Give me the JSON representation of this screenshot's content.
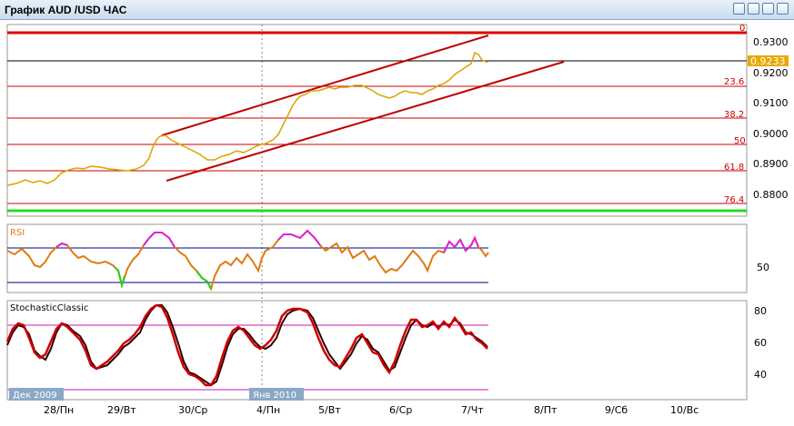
{
  "window": {
    "title": "График AUD /USD  ЧАС",
    "buttons": [
      "pause",
      "tile",
      "maximize",
      "close"
    ]
  },
  "colors": {
    "price": "#d9a400",
    "channel": "#c00000",
    "fib": "#cc0000",
    "fib_top": "#e00000",
    "green_line": "#22dd22",
    "current_price_bg": "#e8a800",
    "rsi_high": "#dd22dd",
    "rsi_mid": "#e07a10",
    "rsi_low": "#22cc22",
    "stoch_main": "#cc0000",
    "stoch_signal": "#330000",
    "stoch_levels": "#dd66cc"
  },
  "price_panel": {
    "current_price": "0.9233",
    "fib_labels": [
      {
        "text": "0",
        "value": 0.9315
      },
      {
        "text": "23.6",
        "value": 0.9173
      },
      {
        "text": "38.2",
        "value": 0.912
      },
      {
        "text": "50",
        "value": 0.9058
      },
      {
        "text": "61.8",
        "value": 0.8995
      },
      {
        "text": "76.4",
        "value": 0.8852
      }
    ],
    "y_ticks": [
      "0.9300",
      "0.9200",
      "0.9100",
      "0.9000",
      "0.8900",
      "0.8800"
    ],
    "green_level": 0.8797,
    "current_line": 0.9233
  },
  "rsi_panel": {
    "label": "RSI",
    "ticks": [
      "50"
    ],
    "levels": [
      70,
      30
    ]
  },
  "stoch_panel": {
    "label": "StochasticClassic",
    "ticks": [
      "80",
      "60",
      "40"
    ],
    "levels": [
      70,
      30
    ]
  },
  "x_axis": {
    "labels": [
      "28/Пн",
      "29/Вт",
      "30/Ср",
      "4/Пн",
      "5/Вт",
      "6/Ср",
      "7/Чт",
      "8/Пт",
      "9/Сб",
      "10/Вс"
    ],
    "month_badges": [
      "Дек 2009",
      "Янв 2010"
    ]
  }
}
